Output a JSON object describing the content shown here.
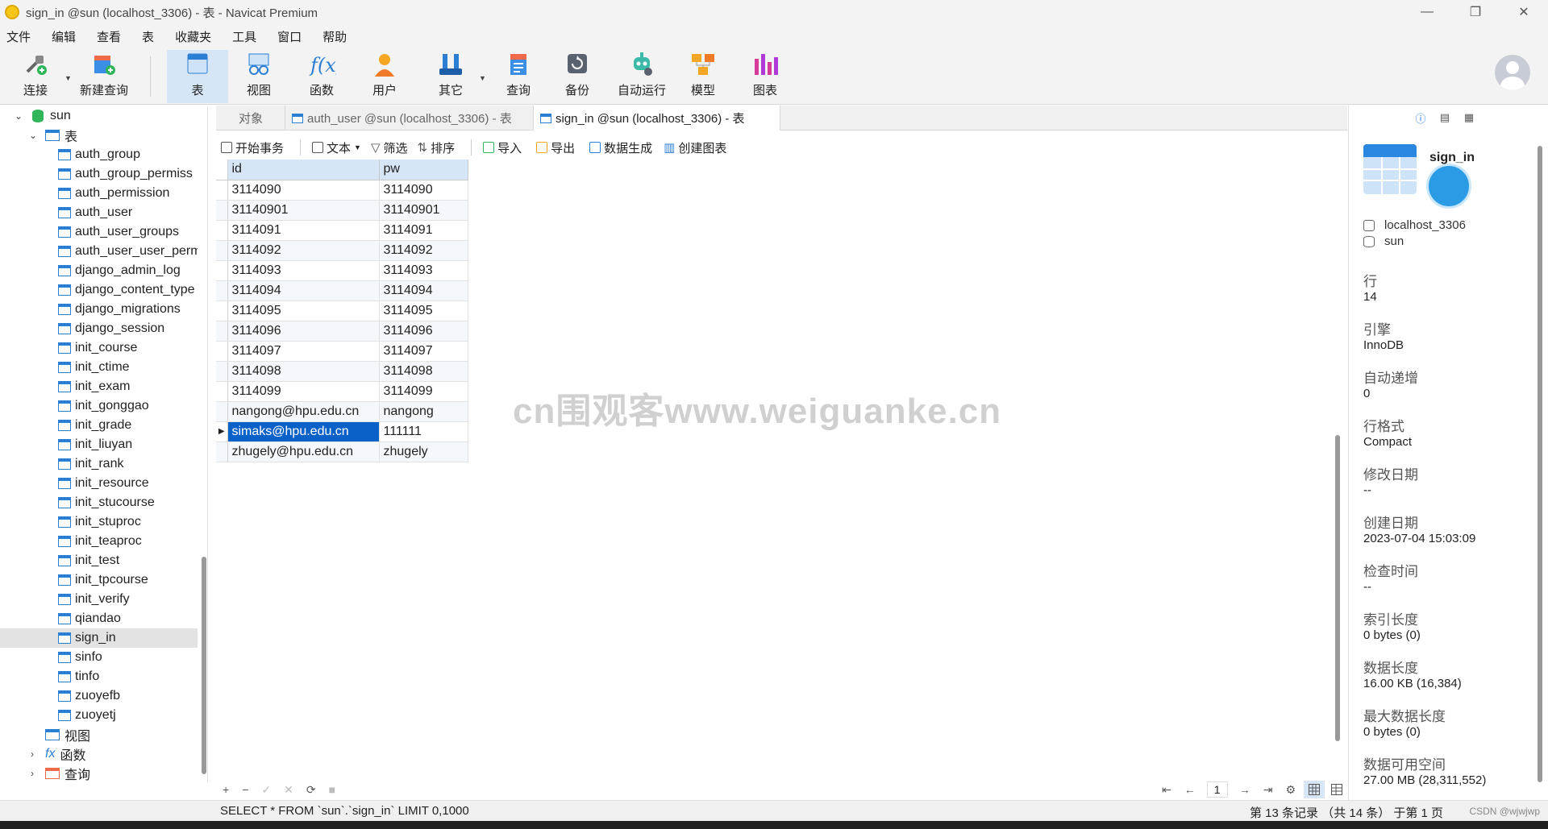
{
  "window": {
    "title": "sign_in @sun (localhost_3306) - 表 - Navicat Premium",
    "controls": [
      "—",
      "❐",
      "✕"
    ]
  },
  "menu": [
    "文件",
    "编辑",
    "查看",
    "表",
    "收藏夹",
    "工具",
    "窗口",
    "帮助"
  ],
  "toolbar": {
    "connect": "连接",
    "new_query": "新建查询",
    "table": "表",
    "view": "视图",
    "function": "函数",
    "user": "用户",
    "other": "其它",
    "query": "查询",
    "backup": "备份",
    "automation": "自动运行",
    "model": "模型",
    "chart": "图表"
  },
  "sidebar": {
    "database": "sun",
    "tables_group": "表",
    "tables": [
      "auth_group",
      "auth_group_permiss",
      "auth_permission",
      "auth_user",
      "auth_user_groups",
      "auth_user_user_perm",
      "django_admin_log",
      "django_content_type",
      "django_migrations",
      "django_session",
      "init_course",
      "init_ctime",
      "init_exam",
      "init_gonggao",
      "init_grade",
      "init_liuyan",
      "init_rank",
      "init_resource",
      "init_stucourse",
      "init_stuproc",
      "init_teaproc",
      "init_test",
      "init_tpcourse",
      "init_verify",
      "qiandao",
      "sign_in",
      "sinfo",
      "tinfo",
      "zuoyefb",
      "zuoyetj"
    ],
    "selected_table": "sign_in",
    "views_group": "视图",
    "functions_group": "函数",
    "queries_group": "查询"
  },
  "tabs": [
    {
      "label": "对象"
    },
    {
      "label": "auth_user @sun (localhost_3306) - 表"
    },
    {
      "label": "sign_in @sun (localhost_3306) - 表"
    }
  ],
  "table_tools": {
    "begin_transaction": "开始事务",
    "text": "文本",
    "filter": "筛选",
    "sort": "排序",
    "import": "导入",
    "export": "导出",
    "data_generation": "数据生成",
    "create_chart": "创建图表"
  },
  "grid": {
    "columns": [
      "id",
      "pw"
    ],
    "rows": [
      [
        "3114090",
        "3114090"
      ],
      [
        "31140901",
        "31140901"
      ],
      [
        "3114091",
        "3114091"
      ],
      [
        "3114092",
        "3114092"
      ],
      [
        "3114093",
        "3114093"
      ],
      [
        "3114094",
        "3114094"
      ],
      [
        "3114095",
        "3114095"
      ],
      [
        "3114096",
        "3114096"
      ],
      [
        "3114097",
        "3114097"
      ],
      [
        "3114098",
        "3114098"
      ],
      [
        "3114099",
        "3114099"
      ],
      [
        "nangong@hpu.edu.cn",
        "nangong"
      ],
      [
        "simaks@hpu.edu.cn",
        "111111"
      ],
      [
        "zhugely@hpu.edu.cn",
        "zhugely"
      ]
    ],
    "selected_row": 12
  },
  "watermark": "cn围观客www.weiguanke.cn",
  "bottom_nav": {
    "add": "+",
    "remove": "−",
    "apply": "✓",
    "discard": "✕",
    "refresh": "⟳",
    "stop": "■",
    "first": "⇤",
    "prev": "←",
    "page": "1",
    "next": "→",
    "last": "⇥",
    "settings": "⚙"
  },
  "status": {
    "sql": "SELECT * FROM `sun`.`sign_in` LIMIT 0,1000",
    "records": "第 13 条记录 （共 14 条） 于第 1 页",
    "credit": "CSDN @wjwjwp"
  },
  "info_panel": {
    "object_name": "sign_in",
    "connection": "localhost_3306",
    "database": "sun",
    "properties": [
      {
        "label": "行",
        "value": "14"
      },
      {
        "label": "引擎",
        "value": "InnoDB"
      },
      {
        "label": "自动递增",
        "value": "0"
      },
      {
        "label": "行格式",
        "value": "Compact"
      },
      {
        "label": "修改日期",
        "value": "--"
      },
      {
        "label": "创建日期",
        "value": "2023-07-04 15:03:09"
      },
      {
        "label": "检查时间",
        "value": "--"
      },
      {
        "label": "索引长度",
        "value": "0 bytes (0)"
      },
      {
        "label": "数据长度",
        "value": "16.00 KB (16,384)"
      },
      {
        "label": "最大数据长度",
        "value": "0 bytes (0)"
      },
      {
        "label": "数据可用空间",
        "value": "27.00 MB (28,311,552)"
      }
    ]
  },
  "colors": {
    "accent": "#2a7fd4",
    "selection": "#0a62c8",
    "header_bg": "#d7e6f7"
  }
}
